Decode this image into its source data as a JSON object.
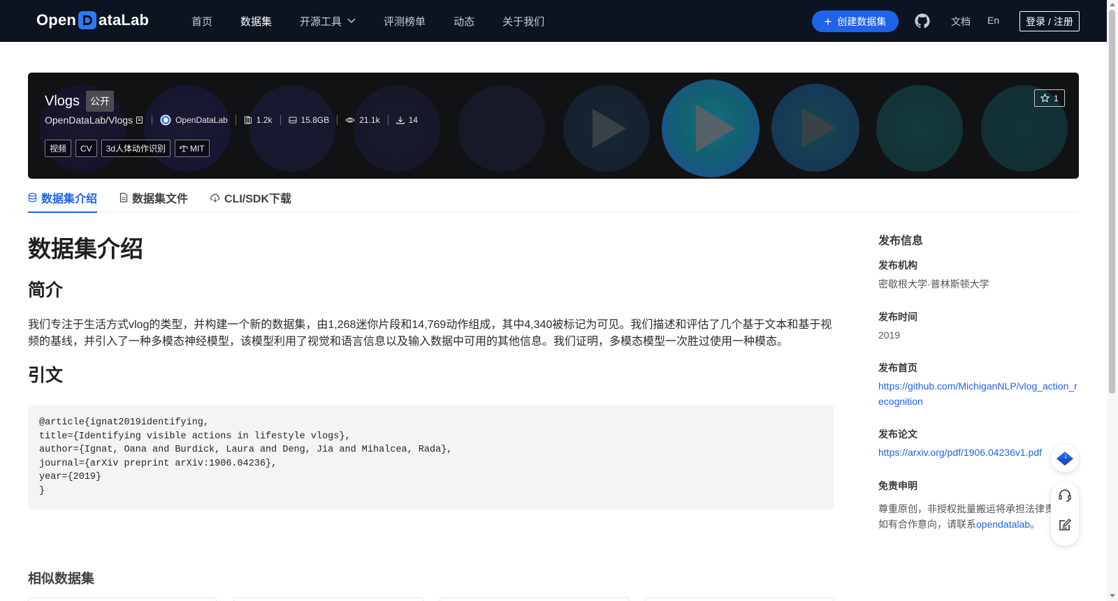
{
  "brand": {
    "logo_prefix": "Open",
    "logo_suffix": "ataLab"
  },
  "nav": {
    "items": [
      {
        "label": "首页"
      },
      {
        "label": "数据集"
      },
      {
        "label": "开源工具"
      },
      {
        "label": "评测榜单"
      },
      {
        "label": "动态"
      },
      {
        "label": "关于我们"
      }
    ],
    "create_label": "创建数据集",
    "docs_label": "文档",
    "lang_label": "En",
    "login_label": "登录 / 注册"
  },
  "dataset": {
    "name": "Vlogs",
    "visibility": "公开",
    "repo": "OpenDataLab/Vlogs",
    "publisher": "OpenDataLab",
    "files": "1.2k",
    "size": "15.8GB",
    "views": "21.1k",
    "downloads": "14",
    "tags": [
      "视频",
      "CV",
      "3d人体动作识别"
    ],
    "license": "MIT",
    "stars": "1"
  },
  "tabs": [
    {
      "label": "数据集介绍"
    },
    {
      "label": "数据集文件"
    },
    {
      "label": "CLI/SDK下载"
    }
  ],
  "content": {
    "title": "数据集介绍",
    "intro_heading": "简介",
    "intro_text": "我们专注于生活方式vlog的类型，并构建一个新的数据集，由1,268迷你片段和14,769动作组成，其中4,340被标记为可见。我们描述和评估了几个基于文本和基于视频的基线，并引入了一种多模态神经模型，该模型利用了视觉和语言信息以及输入数据中可用的其他信息。我们证明，多模态模型一次胜过使用一种模态。",
    "citation_heading": "引文",
    "citation": "@article{ignat2019identifying,\ntitle={Identifying visible actions in lifestyle vlogs},\nauthor={Ignat, Oana and Burdick, Laura and Deng, Jia and Mihalcea, Rada},\njournal={arXiv preprint arXiv:1906.04236},\nyear={2019}\n}",
    "similar_heading": "相似数据集"
  },
  "sidebar": {
    "title": "发布信息",
    "org_label": "发布机构",
    "org_value": "密歇根大学·普林斯顿大学",
    "date_label": "发布时间",
    "date_value": "2019",
    "homepage_label": "发布首页",
    "homepage_value": "https://github.com/MichiganNLP/vlog_action_recognition",
    "paper_label": "发布论文",
    "paper_value": "https://arxiv.org/pdf/1906.04236v1.pdf",
    "disclaimer_label": "免责申明",
    "disclaimer_line1": "尊重原创，非授权批量搬运将承担法律责任",
    "disclaimer_line2_prefix": "如有合作意向，请联系",
    "disclaimer_link": "opendatalab",
    "disclaimer_line2_suffix": "。"
  },
  "colors": {
    "nav_bg": "#0d1421",
    "accent": "#1f63e9",
    "banner_bg": "#111214"
  }
}
